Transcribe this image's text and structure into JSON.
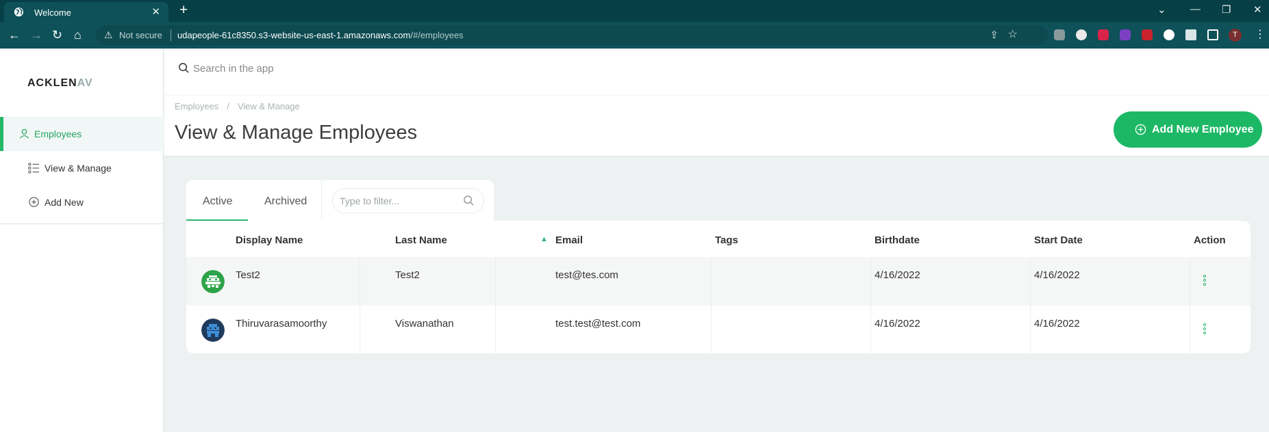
{
  "browser": {
    "tab_title": "Welcome",
    "not_secure": "Not secure",
    "url_host": "udapeople-61c8350.s3-website-us-east-1.amazonaws.com",
    "url_path": "/#/employees",
    "profile_initial": "T"
  },
  "sidebar": {
    "logo_main": "ACKLEN",
    "logo_faded": "AV",
    "items": [
      {
        "label": "Employees",
        "icon": "user-icon",
        "active": true
      },
      {
        "label": "View & Manage",
        "icon": "list-icon",
        "active": false
      },
      {
        "label": "Add New",
        "icon": "plus-circle-icon",
        "active": false
      }
    ]
  },
  "header": {
    "search_placeholder": "Search in the app",
    "breadcrumb": [
      "Employees",
      "View & Manage"
    ],
    "title": "View & Manage Employees",
    "add_button_label": "Add New Employee"
  },
  "tabs": {
    "items": [
      "Active",
      "Archived"
    ],
    "active": "Active",
    "filter_placeholder": "Type to filter..."
  },
  "table": {
    "columns": [
      "Display Name",
      "Last Name",
      "Email",
      "Tags",
      "Birthdate",
      "Start Date",
      "Action"
    ],
    "sorted_column": "Email",
    "rows": [
      {
        "display_name": "Test2",
        "last_name": "Test2",
        "email": "test@tes.com",
        "tags": "",
        "birthdate": "4/16/2022",
        "start_date": "4/16/2022"
      },
      {
        "display_name": "Thiruvarasamoorthy",
        "last_name": "Viswanathan",
        "email": "test.test@test.com",
        "tags": "",
        "birthdate": "4/16/2022",
        "start_date": "4/16/2022"
      }
    ]
  },
  "colors": {
    "accent": "#1db865",
    "browser_frame": "#063f45",
    "browser_toolbar": "#0e5158",
    "page_bg": "#eef1f1"
  }
}
